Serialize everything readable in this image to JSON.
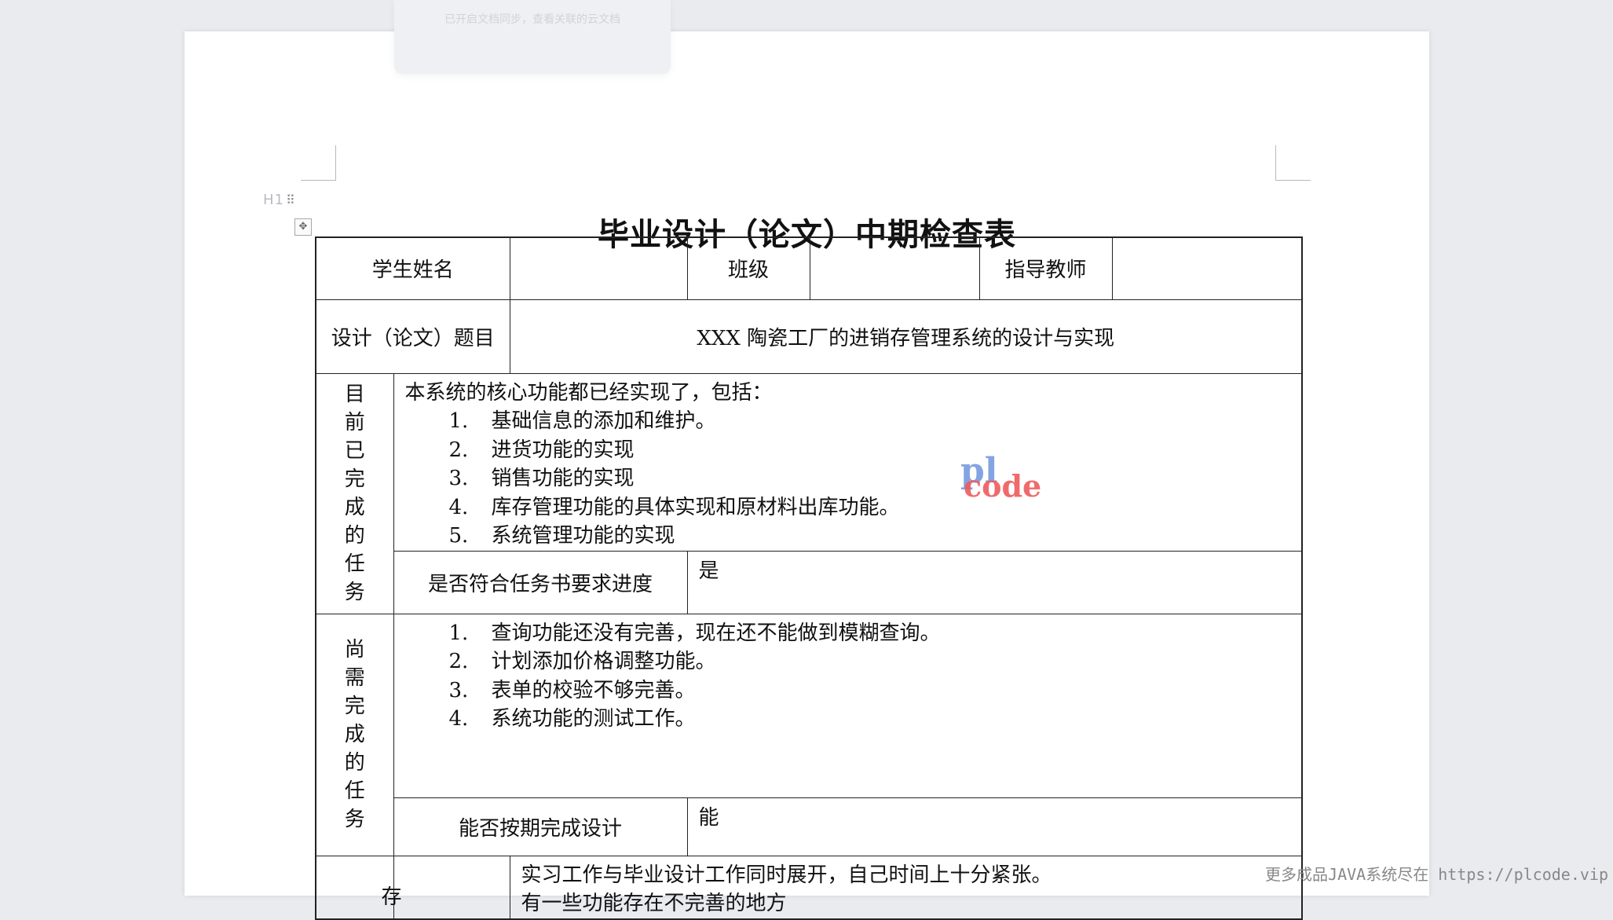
{
  "toast": {
    "text": "已开启文档同步，查看关联的云文档"
  },
  "heading_marker": {
    "label": "H1",
    "grip": "⠿"
  },
  "move_handle_icon": "✥",
  "title": "毕业设计（论文）中期检查表",
  "form": {
    "row1": {
      "student_name_label": "学生姓名",
      "student_name_value": "",
      "class_label": "班级",
      "class_value": "",
      "advisor_label": "指导教师",
      "advisor_value": ""
    },
    "topic": {
      "label": "设计（论文）题目",
      "value": "XXX 陶瓷工厂的进销存管理系统的设计与实现"
    },
    "completed": {
      "section_label": [
        "目",
        "前",
        "已",
        "完",
        "成",
        "的",
        "任",
        "务"
      ],
      "intro": "本系统的核心功能都已经实现了，包括：",
      "items": [
        {
          "num": "1.",
          "text": "基础信息的添加和维护。"
        },
        {
          "num": "2.",
          "text": "进货功能的实现"
        },
        {
          "num": "3.",
          "text": "销售功能的实现"
        },
        {
          "num": "4.",
          "text": "库存管理功能的具体实现和原材料出库功能。"
        },
        {
          "num": "5.",
          "text": "系统管理功能的实现"
        }
      ],
      "progress_label": "是否符合任务书要求进度",
      "progress_value": "是"
    },
    "remaining": {
      "section_label": [
        "尚",
        "需",
        "完",
        "成",
        "的",
        "任",
        "务"
      ],
      "items": [
        {
          "num": "1.",
          "text": "查询功能还没有完善，现在还不能做到模糊查询。"
        },
        {
          "num": "2.",
          "text": "计划添加价格调整功能。"
        },
        {
          "num": "3.",
          "text": "表单的校验不够完善。"
        },
        {
          "num": "4.",
          "text": "系统功能的测试工作。"
        }
      ],
      "ontime_label": "能否按期完成设计",
      "ontime_value": "能"
    },
    "problems": {
      "sub_label_partial": "存",
      "line1": "实习工作与毕业设计工作同时展开，自己时间上十分紧张。",
      "line2_partial": "有一些功能存在不完善的地方"
    }
  },
  "watermark": {
    "top": "pl",
    "bottom": "code"
  },
  "footer_note": "更多成品JAVA系统尽在 https://plcode.vip"
}
